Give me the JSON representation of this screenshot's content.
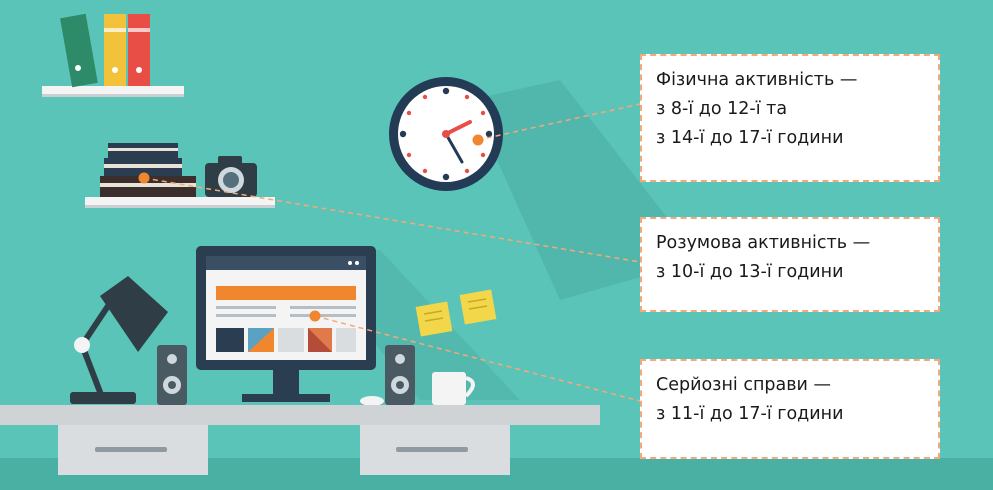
{
  "callouts": {
    "physical": {
      "lines": [
        "Фізична активність —",
        "з 8-ї до 12-ї та",
        "з 14-ї до 17-ї години"
      ]
    },
    "mental": {
      "lines": [
        "Розумова активність —",
        "з 10-ї до 13-ї години"
      ]
    },
    "serious": {
      "lines": [
        "Серйозні справи —",
        "з 11-ї до 17-ї години"
      ]
    }
  },
  "colors": {
    "background": "#5ac4b9",
    "floor": "#4ab0a4",
    "desk": "#cfd3d6",
    "accent_orange": "#f0862e",
    "clock_rim": "#243b55",
    "callout_border": "#f6a878"
  },
  "icons": [
    "clock-icon",
    "monitor-icon",
    "desk-lamp-icon",
    "camera-icon",
    "mug-icon",
    "speaker-icon",
    "sticky-note-icon",
    "book-icon",
    "mouse-icon"
  ]
}
